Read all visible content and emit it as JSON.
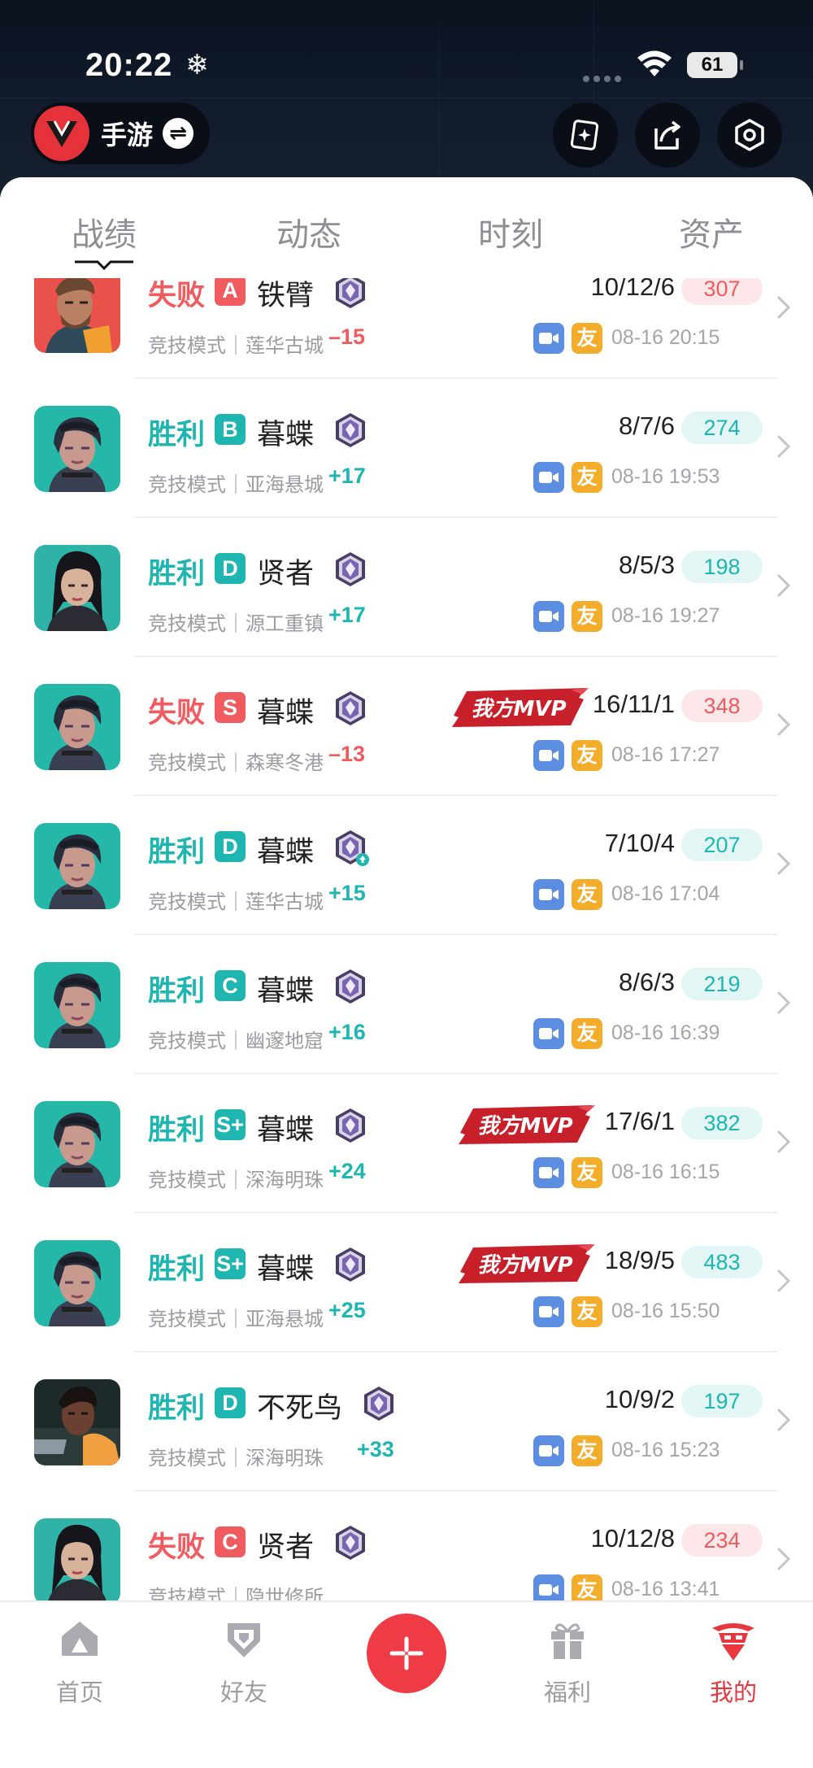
{
  "status_bar": {
    "time": "20:22",
    "battery": "61"
  },
  "header": {
    "game_name": "手游"
  },
  "tabs": [
    {
      "label": "战绩",
      "active": true
    },
    {
      "label": "动态",
      "active": false
    },
    {
      "label": "时刻",
      "active": false
    },
    {
      "label": "资产",
      "active": false
    }
  ],
  "matches": [
    {
      "result": "失败",
      "outcome": "loss",
      "grade": "A",
      "hero": "铁臂",
      "mode": "竞技模式｜莲华古城",
      "delta": "–15",
      "kda": "10/12/6",
      "score": "307",
      "mvp": false,
      "time": "08-16 20:15",
      "avatar": "tiebi"
    },
    {
      "result": "胜利",
      "outcome": "win",
      "grade": "B",
      "hero": "暮蝶",
      "mode": "竞技模式｜亚海悬城",
      "delta": "+17",
      "kda": "8/7/6",
      "score": "274",
      "mvp": false,
      "time": "08-16 19:53",
      "avatar": "mudie"
    },
    {
      "result": "胜利",
      "outcome": "win",
      "grade": "D",
      "hero": "贤者",
      "mode": "竞技模式｜源工重镇",
      "delta": "+17",
      "kda": "8/5/3",
      "score": "198",
      "mvp": false,
      "time": "08-16 19:27",
      "avatar": "xianzhe"
    },
    {
      "result": "失败",
      "outcome": "loss",
      "grade": "S",
      "hero": "暮蝶",
      "mode": "竞技模式｜森寒冬港",
      "delta": "–13",
      "kda": "16/11/1",
      "score": "348",
      "mvp": true,
      "time": "08-16 17:27",
      "avatar": "mudie"
    },
    {
      "result": "胜利",
      "outcome": "win",
      "grade": "D",
      "hero": "暮蝶",
      "mode": "竞技模式｜莲华古城",
      "delta": "+15",
      "kda": "7/10/4",
      "score": "207",
      "mvp": false,
      "time": "08-16 17:04",
      "avatar": "mudie",
      "rank_up": true
    },
    {
      "result": "胜利",
      "outcome": "win",
      "grade": "C",
      "hero": "暮蝶",
      "mode": "竞技模式｜幽邃地窟",
      "delta": "+16",
      "kda": "8/6/3",
      "score": "219",
      "mvp": false,
      "time": "08-16 16:39",
      "avatar": "mudie"
    },
    {
      "result": "胜利",
      "outcome": "win",
      "grade": "S+",
      "hero": "暮蝶",
      "mode": "竞技模式｜深海明珠",
      "delta": "+24",
      "kda": "17/6/1",
      "score": "382",
      "mvp": true,
      "time": "08-16 16:15",
      "avatar": "mudie"
    },
    {
      "result": "胜利",
      "outcome": "win",
      "grade": "S+",
      "hero": "暮蝶",
      "mode": "竞技模式｜亚海悬城",
      "delta": "+25",
      "kda": "18/9/5",
      "score": "483",
      "mvp": true,
      "time": "08-16 15:50",
      "avatar": "mudie"
    },
    {
      "result": "胜利",
      "outcome": "win",
      "grade": "D",
      "hero": "不死鸟",
      "mode": "竞技模式｜深海明珠",
      "delta": "+33",
      "kda": "10/9/2",
      "score": "197",
      "mvp": false,
      "time": "08-16 15:23",
      "avatar": "busiliao"
    },
    {
      "result": "失败",
      "outcome": "loss",
      "grade": "C",
      "hero": "贤者",
      "mode": "竞技模式｜隐世修所",
      "delta": "",
      "kda": "10/12/8",
      "score": "234",
      "mvp": false,
      "time": "08-16 13:41",
      "avatar": "xianzhe"
    }
  ],
  "mvp_label": "我方MVP",
  "friend_badge": "友",
  "bottom_nav": [
    {
      "label": "首页",
      "icon": "home-icon",
      "active": false
    },
    {
      "label": "好友",
      "icon": "friends-icon",
      "active": false
    },
    {
      "label": "福利",
      "icon": "gift-icon",
      "active": false
    },
    {
      "label": "我的",
      "icon": "profile-icon",
      "active": true
    }
  ],
  "colors": {
    "win": "#1fb5b0",
    "loss": "#ef5b5f",
    "accent": "#ee3b45",
    "mvp": "#c8202b"
  }
}
